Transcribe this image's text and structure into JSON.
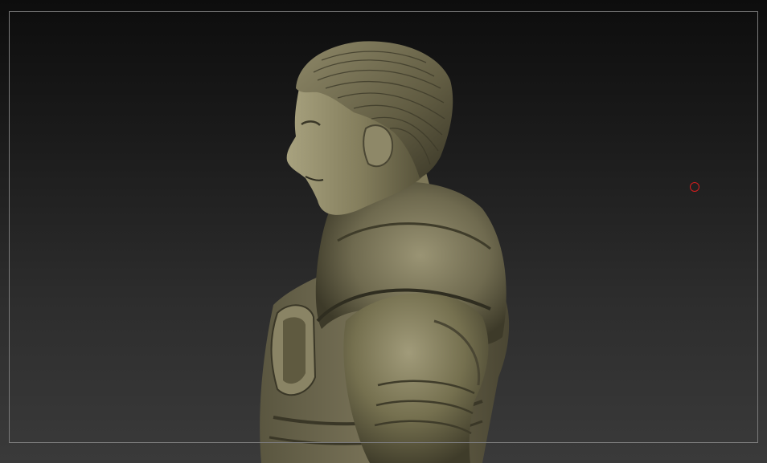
{
  "viewport": {
    "background_top": "#0d0d0d",
    "background_bottom": "#3a3a3a",
    "frame_color": "#7a7a7a"
  },
  "model": {
    "name": "sculpt-bust-figure",
    "material_color": "#6e6a4e",
    "highlight_color": "#a39f7c",
    "shadow_color": "#2f2d20"
  },
  "cursor": {
    "icon": "brush-circle-icon",
    "color": "#d41e1e"
  }
}
